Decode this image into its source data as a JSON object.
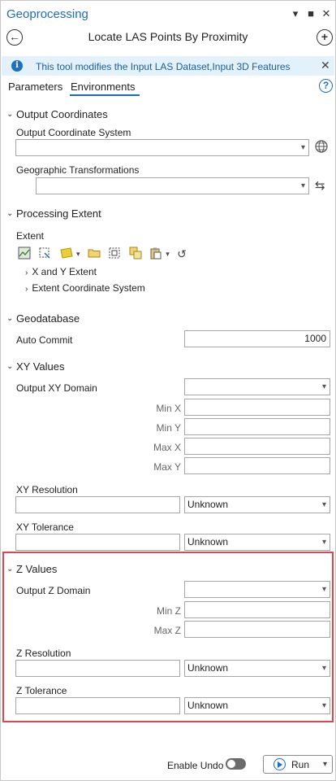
{
  "header": {
    "app_title": "Geoprocessing",
    "tool_title": "Locate LAS Points By Proximity",
    "window_buttons": [
      "chevron-down-icon",
      "maximize-icon",
      "close-icon"
    ]
  },
  "info_bar": {
    "text": "This tool modifies the Input LAS Dataset,Input 3D Features"
  },
  "tabs": [
    {
      "label": "Parameters",
      "active": false
    },
    {
      "label": "Environments",
      "active": true
    }
  ],
  "output_coordinates": {
    "title": "Output Coordinates",
    "coord_system_label": "Output Coordinate System",
    "coord_system_value": "",
    "geo_transform_label": "Geographic Transformations",
    "geo_transform_value": ""
  },
  "processing_extent": {
    "title": "Processing Extent",
    "extent_label": "Extent",
    "tree_items": [
      "X and Y Extent",
      "Extent Coordinate System"
    ]
  },
  "geodatabase": {
    "title": "Geodatabase",
    "auto_commit_label": "Auto Commit",
    "auto_commit_value": "1000"
  },
  "xy_values": {
    "title": "XY Values",
    "domain_label": "Output XY Domain",
    "min_x_label": "Min X",
    "min_y_label": "Min Y",
    "max_x_label": "Max X",
    "max_y_label": "Max Y",
    "resolution_label": "XY Resolution",
    "resolution_unit": "Unknown",
    "tolerance_label": "XY Tolerance",
    "tolerance_unit": "Unknown"
  },
  "z_values": {
    "title": "Z Values",
    "domain_label": "Output Z Domain",
    "min_z_label": "Min Z",
    "max_z_label": "Max Z",
    "resolution_label": "Z Resolution",
    "resolution_unit": "Unknown",
    "tolerance_label": "Z Tolerance",
    "tolerance_unit": "Unknown"
  },
  "footer": {
    "enable_undo_label": "Enable Undo",
    "enable_undo_on": false,
    "run_label": "Run"
  },
  "colors": {
    "accent": "#1e6bb8",
    "info_bg": "#e3f1fb",
    "highlight": "#e0474c"
  }
}
